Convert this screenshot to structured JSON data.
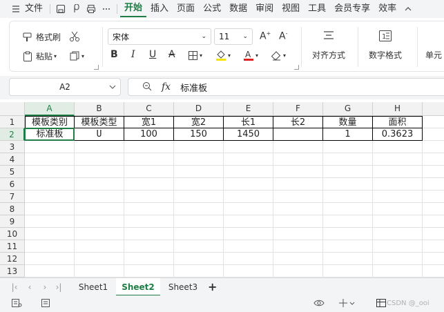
{
  "menu": {
    "file": "文件",
    "tabs": [
      {
        "label": "开始",
        "active": true
      },
      {
        "label": "插入"
      },
      {
        "label": "页面"
      },
      {
        "label": "公式"
      },
      {
        "label": "数据"
      },
      {
        "label": "审阅"
      },
      {
        "label": "视图"
      },
      {
        "label": "工具"
      },
      {
        "label": "会员专享"
      },
      {
        "label": "效率"
      }
    ]
  },
  "ribbon": {
    "format_painter": "格式刷",
    "paste": "粘贴",
    "font_name": "宋体",
    "font_size": "11",
    "align": "对齐方式",
    "number_format": "数字格式",
    "cell": "单元"
  },
  "formula_bar": {
    "name_box": "A2",
    "fx": "fx",
    "value": "标准板"
  },
  "grid": {
    "columns": [
      "A",
      "B",
      "C",
      "D",
      "E",
      "F",
      "G",
      "H"
    ],
    "rows": [
      "1",
      "2",
      "3",
      "4",
      "5",
      "6",
      "7",
      "8",
      "9",
      "10",
      "11",
      "12",
      "13",
      "14"
    ],
    "selected_cell": "A2",
    "data": [
      [
        "模板类别",
        "模板类型",
        "宽1",
        "宽2",
        "长1",
        "长2",
        "数量",
        "面积"
      ],
      [
        "标准板",
        "U",
        "100",
        "150",
        "1450",
        "",
        "1",
        "0.3623"
      ]
    ]
  },
  "sheets": [
    {
      "name": "Sheet1"
    },
    {
      "name": "Sheet2",
      "active": true
    },
    {
      "name": "Sheet3"
    }
  ],
  "status": {
    "watermark": "CSDN @_ooi"
  },
  "colors": {
    "accent": "#1e7e45",
    "font_color": "#e02020",
    "highlight": "#f5e400"
  }
}
